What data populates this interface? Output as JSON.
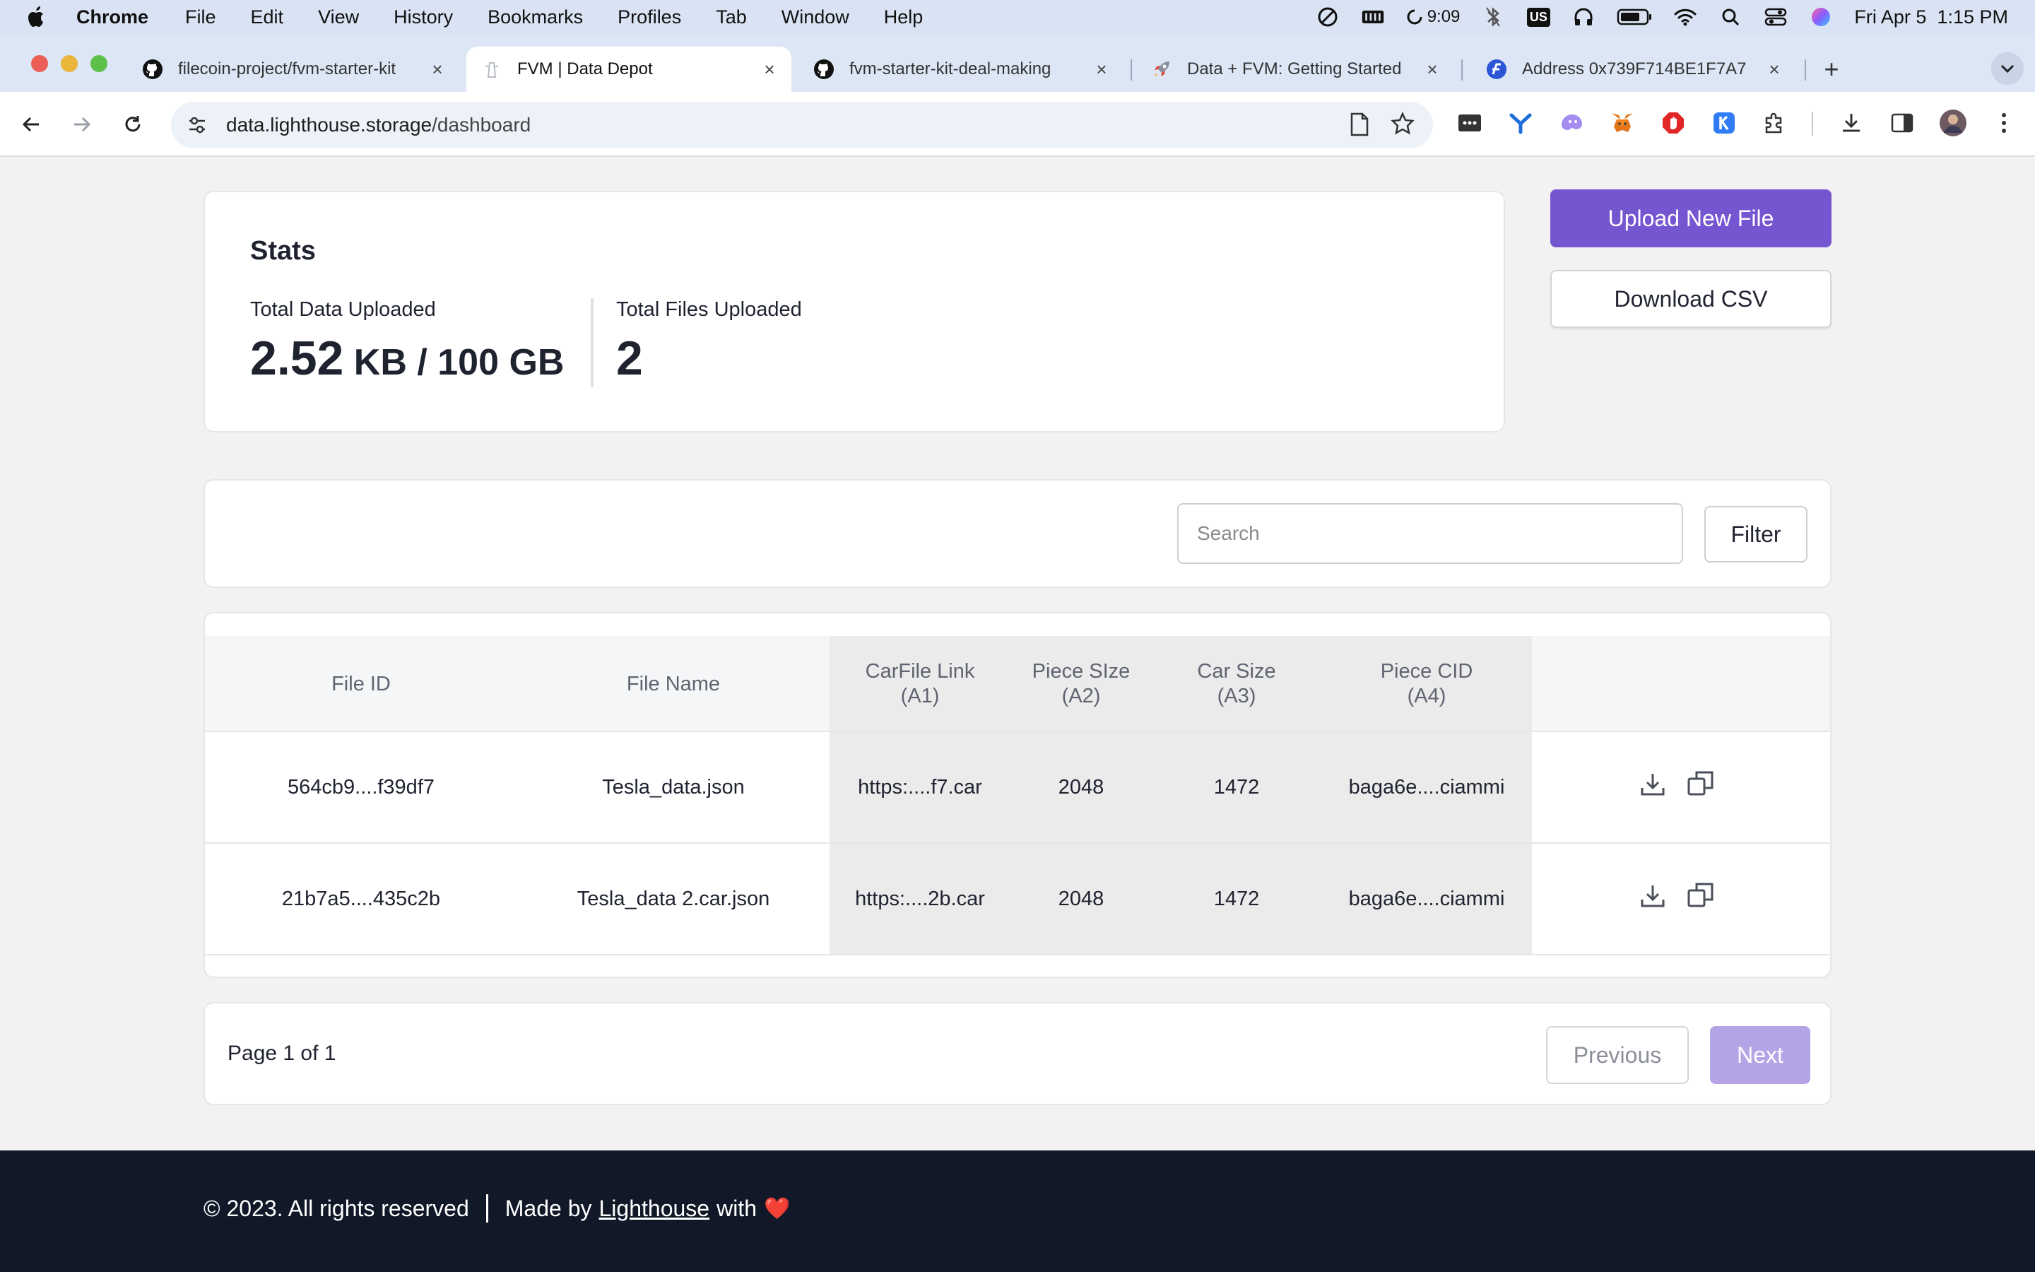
{
  "menubar": {
    "app": "Chrome",
    "items": [
      "File",
      "Edit",
      "View",
      "History",
      "Bookmarks",
      "Profiles",
      "Tab",
      "Window",
      "Help"
    ],
    "timer": "9:09",
    "keyboard": "US",
    "datetime": "Fri Apr 5  1:15 PM"
  },
  "tabs": [
    {
      "label": "filecoin-project/fvm-starter-kit",
      "favicon": "github-icon"
    },
    {
      "label": "FVM | Data Depot",
      "favicon": "lighthouse-icon"
    },
    {
      "label": "fvm-starter-kit-deal-making",
      "favicon": "github-icon"
    },
    {
      "label": "Data + FVM: Getting Started",
      "favicon": "rocket-icon"
    },
    {
      "label": "Address 0x739F714BE1F7A7",
      "favicon": "filfox-icon"
    }
  ],
  "address_bar": {
    "domain": "data.lighthouse.storage",
    "path": "/dashboard"
  },
  "stats": {
    "title": "Stats",
    "data_label": "Total Data Uploaded",
    "data_value": "2.52",
    "data_unit": " KB / 100 GB",
    "files_label": "Total Files Uploaded",
    "files_value": "2"
  },
  "actions": {
    "upload": "Upload New File",
    "download_csv": "Download CSV"
  },
  "search": {
    "placeholder": "Search",
    "filter": "Filter"
  },
  "table": {
    "headers": {
      "file_id": "File ID",
      "file_name": "File Name",
      "car_link_1": "CarFile Link",
      "car_link_2": "(A1)",
      "piece_size_1": "Piece SIze",
      "piece_size_2": "(A2)",
      "car_size_1": "Car Size",
      "car_size_2": "(A3)",
      "piece_cid_1": "Piece CID",
      "piece_cid_2": "(A4)"
    },
    "rows": [
      {
        "file_id": "564cb9....f39df7",
        "file_name": "Tesla_data.json",
        "car_link": "https:....f7.car",
        "piece_size": "2048",
        "car_size": "1472",
        "piece_cid": "baga6e....ciammi"
      },
      {
        "file_id": "21b7a5....435c2b",
        "file_name": "Tesla_data 2.car.json",
        "car_link": "https:....2b.car",
        "piece_size": "2048",
        "car_size": "1472",
        "piece_cid": "baga6e....ciammi"
      }
    ]
  },
  "pagination": {
    "text": "Page 1 of 1",
    "previous": "Previous",
    "next": "Next"
  },
  "footer": {
    "copyright": "© 2023. All rights reserved",
    "made_by": "Made by",
    "link": "Lighthouse",
    "with": "with",
    "heart": "❤️"
  },
  "colors": {
    "accent": "#7655d0",
    "accent_disabled": "#b4a4e6",
    "footer_bg": "#111827",
    "page_bg": "#f2f2f2"
  }
}
